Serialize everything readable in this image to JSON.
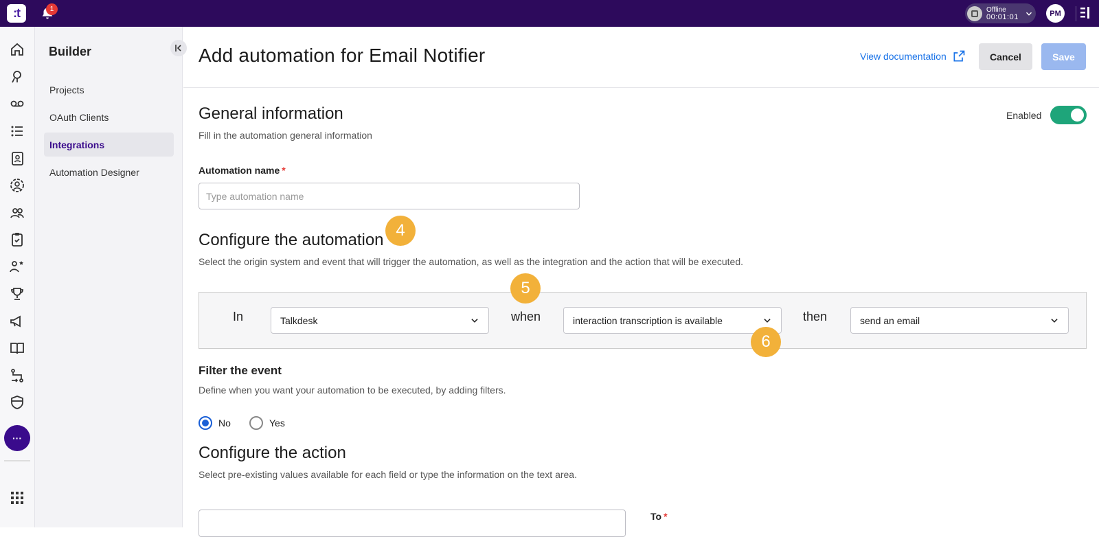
{
  "topbar": {
    "logo_text": ":t",
    "notification_count": "1",
    "status": {
      "label": "Offline",
      "timer": "00:01:01"
    },
    "avatar_initials": "PM"
  },
  "rail": {
    "icons": [
      "home-icon",
      "agent-icon",
      "voicemail-icon",
      "list-icon",
      "contacts-icon",
      "user-circle-icon",
      "team-icon",
      "clipboard-check-icon",
      "people-star-icon",
      "trophy-icon",
      "megaphone-icon",
      "book-icon",
      "flow-icon",
      "shield-icon"
    ],
    "more_label": "···",
    "apps_icon": "grid-icon"
  },
  "nav": {
    "title": "Builder",
    "items": [
      {
        "label": "Projects",
        "active": false
      },
      {
        "label": "OAuth Clients",
        "active": false
      },
      {
        "label": "Integrations",
        "active": true
      },
      {
        "label": "Automation Designer",
        "active": false
      }
    ]
  },
  "header": {
    "title": "Add automation for Email Notifier",
    "doc_link": "View documentation",
    "cancel": "Cancel",
    "save": "Save"
  },
  "general": {
    "heading": "General information",
    "subtitle": "Fill in the automation general information",
    "enabled_label": "Enabled",
    "enabled": true,
    "name_label": "Automation name",
    "required_mark": "*",
    "name_value": "",
    "name_placeholder": "Type automation name"
  },
  "configure": {
    "heading": "Configure the automation",
    "subtitle": "Select the origin system and event that will trigger the automation, as well as the integration and the action that will be executed.",
    "word_in": "In",
    "origin": "Talkdesk",
    "word_when": "when",
    "event": "interaction transcription is available",
    "word_then": "then",
    "action": "send an email"
  },
  "steps": {
    "four": "4",
    "five": "5",
    "six": "6"
  },
  "filter": {
    "heading": "Filter the event",
    "subtitle": "Define when you want your automation to be executed, by adding filters.",
    "option_no": "No",
    "option_yes": "Yes",
    "selected": "No"
  },
  "action": {
    "heading": "Configure the action",
    "subtitle": "Select pre-existing values available for each field or type the information on the text area.",
    "to_label": "To",
    "required_mark": "*"
  },
  "colors": {
    "topbar": "#2d0a5c",
    "accent": "#3a0b8c",
    "link": "#1a73e8",
    "toggle_on": "#1ea57a",
    "step_marker": "#f2b13a",
    "save_disabled": "#9ab8ef"
  }
}
